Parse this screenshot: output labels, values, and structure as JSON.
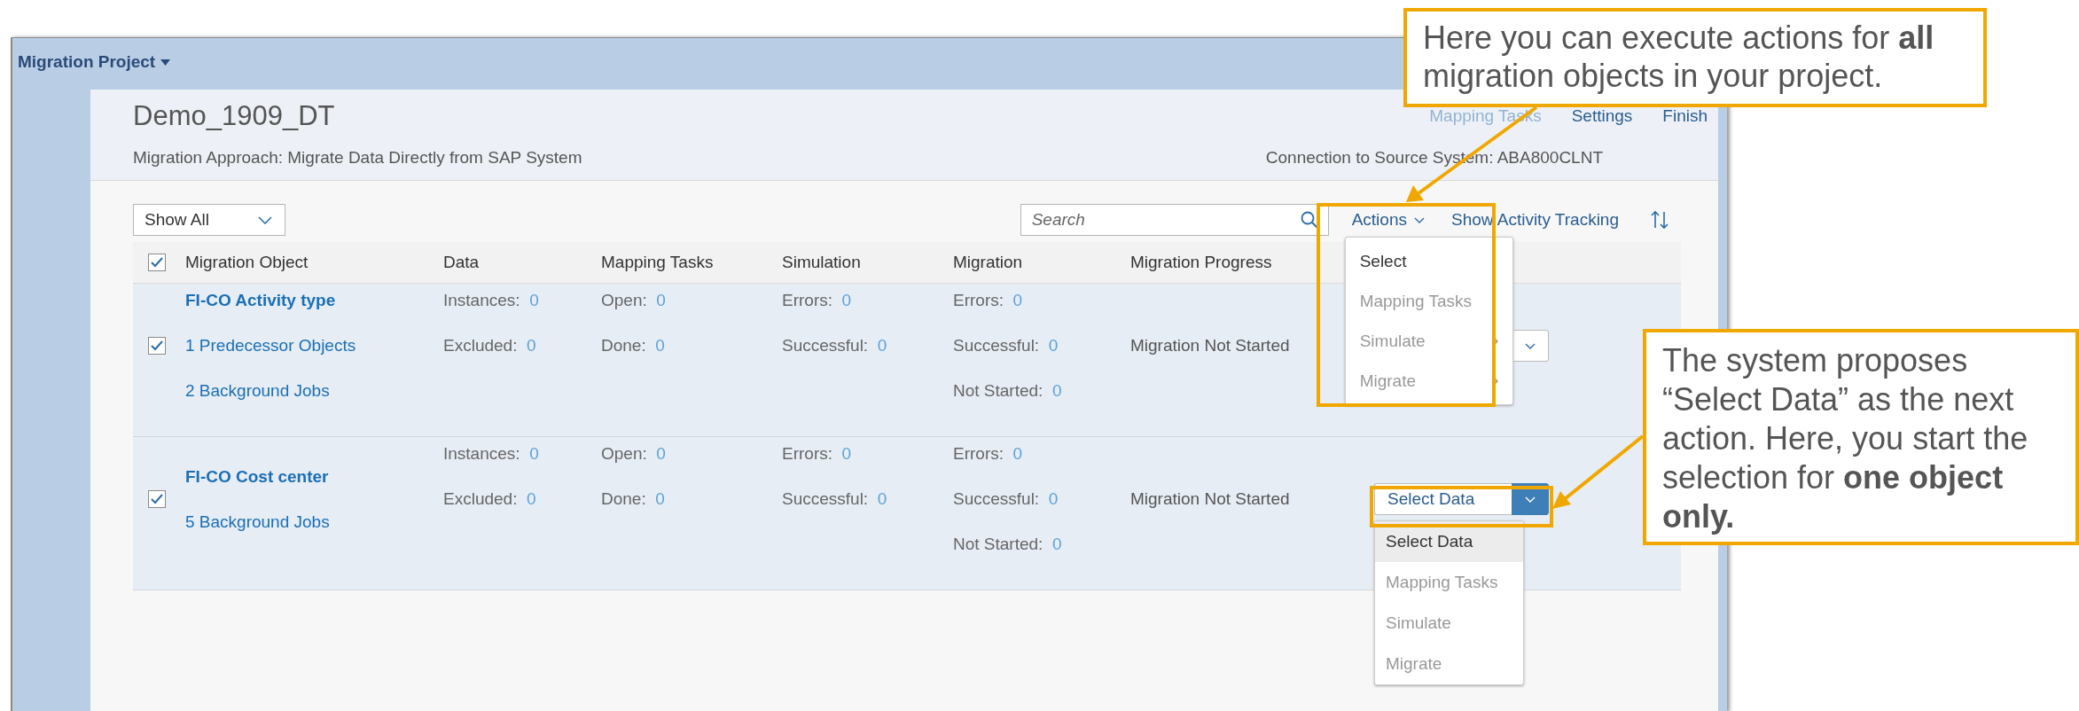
{
  "app_bar": {
    "title": "Migration Project"
  },
  "project": {
    "title": "Demo_1909_DT",
    "approach": "Migration Approach: Migrate Data Directly from SAP System",
    "connection": "Connection to Source System: ABA800CLNT",
    "links": [
      {
        "label": "Mapping Tasks",
        "disabled": true
      },
      {
        "label": "Settings",
        "disabled": false
      },
      {
        "label": "Finish",
        "disabled": false
      }
    ]
  },
  "toolbar": {
    "filter": "Show All",
    "search": {
      "placeholder": "Search"
    },
    "activity_link": "Show Activity Tracking",
    "actions": {
      "label": "Actions",
      "items": [
        {
          "label": "Select",
          "disabled": false,
          "submenu": false
        },
        {
          "label": "Mapping Tasks",
          "disabled": true,
          "submenu": false
        },
        {
          "label": "Simulate",
          "disabled": true,
          "submenu": true
        },
        {
          "label": "Migrate",
          "disabled": true,
          "submenu": true
        }
      ]
    }
  },
  "table": {
    "header_checked": true,
    "columns": [
      "Migration Object",
      "Data",
      "Mapping Tasks",
      "Simulation",
      "Migration",
      "Migration Progress"
    ],
    "rows": [
      {
        "checked": true,
        "object": "FI-CO Activity type",
        "links": [
          "1 Predecessor Objects",
          "2 Background Jobs"
        ],
        "data": [
          {
            "label": "Instances:",
            "value": "0"
          },
          {
            "label": "Excluded:",
            "value": "0"
          }
        ],
        "mapping": [
          {
            "label": "Open:",
            "value": "0"
          },
          {
            "label": "Done:",
            "value": "0"
          }
        ],
        "simulation": [
          {
            "label": "Errors:",
            "value": "0"
          },
          {
            "label": "Successful:",
            "value": "0"
          }
        ],
        "migration": [
          {
            "label": "Errors:",
            "value": "0"
          },
          {
            "label": "Successful:",
            "value": "0"
          },
          {
            "label": "Not Started:",
            "value": "0"
          }
        ],
        "progress": "Migration Not Started",
        "action_button": {
          "expanded": false
        }
      },
      {
        "checked": true,
        "object": "FI-CO Cost center",
        "links": [
          "5 Background Jobs"
        ],
        "data": [
          {
            "label": "Instances:",
            "value": "0"
          },
          {
            "label": "Excluded:",
            "value": "0"
          }
        ],
        "mapping": [
          {
            "label": "Open:",
            "value": "0"
          },
          {
            "label": "Done:",
            "value": "0"
          }
        ],
        "simulation": [
          {
            "label": "Errors:",
            "value": "0"
          },
          {
            "label": "Successful:",
            "value": "0"
          }
        ],
        "migration": [
          {
            "label": "Errors:",
            "value": "0"
          },
          {
            "label": "Successful:",
            "value": "0"
          },
          {
            "label": "Not Started:",
            "value": "0"
          }
        ],
        "progress": "Migration Not Started",
        "action_button": {
          "label": "Select Data",
          "expanded": true,
          "items": [
            {
              "label": "Select Data",
              "selected": true,
              "disabled": false
            },
            {
              "label": "Mapping Tasks",
              "selected": false,
              "disabled": true
            },
            {
              "label": "Simulate",
              "selected": false,
              "disabled": true
            },
            {
              "label": "Migrate",
              "selected": false,
              "disabled": true
            }
          ]
        }
      }
    ]
  },
  "callouts": [
    {
      "text": "Here you can execute actions for **all** migration objects in your project."
    },
    {
      "text": "The system proposes “Select Data” as the next action. Here, you start the selection for **one object only.**"
    }
  ]
}
